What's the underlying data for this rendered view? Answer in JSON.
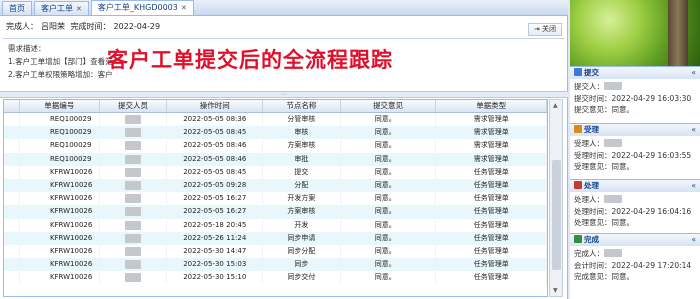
{
  "tabs": [
    {
      "label": "首页",
      "closable": false,
      "active": false
    },
    {
      "label": "客户工单",
      "closable": true,
      "active": false
    },
    {
      "label": "客户工单_KHGD0003",
      "closable": true,
      "active": true
    }
  ],
  "info": {
    "completer_label": "完成人：",
    "completer_value": "吕阳荣",
    "complete_time_label": "完成时间：",
    "complete_time_value": "2022-04-29",
    "close_button": "关闭",
    "desc_title": "需求描述：",
    "desc_line1": "1.客户工单增加【部门】查看范",
    "desc_line2": "2.客户工单权限策略增加：客户"
  },
  "overlay_title": "客户工单提交后的全流程跟踪",
  "grid": {
    "columns": [
      "单据编号",
      "提交人员",
      "操作时间",
      "节点名称",
      "提交意见",
      "单据类型"
    ],
    "rows": [
      [
        "REQ100029",
        "2022-05-05 08:36",
        "分管审核",
        "同意。",
        "需求管理单"
      ],
      [
        "REQ100029",
        "2022-05-05 08:45",
        "审核",
        "同意。",
        "需求管理单"
      ],
      [
        "REQ100029",
        "2022-05-05 08:46",
        "方案审核",
        "同意。",
        "需求管理单"
      ],
      [
        "REQ100029",
        "2022-05-05 08:46",
        "审批",
        "同意。",
        "需求管理单"
      ],
      [
        "KFRW10026",
        "2022-05-05 08:45",
        "提交",
        "同意。",
        "任务管理单"
      ],
      [
        "KFRW10026",
        "2022-05-05 09:28",
        "分配",
        "同意。",
        "任务管理单"
      ],
      [
        "KFRW10026",
        "2022-05-05 16:27",
        "开发方案",
        "同意。",
        "任务管理单"
      ],
      [
        "KFRW10026",
        "2022-05-05 16:27",
        "方案审核",
        "同意。",
        "任务管理单"
      ],
      [
        "KFRW10026",
        "2022-05-18 20:45",
        "开发",
        "同意。",
        "任务管理单"
      ],
      [
        "KFRW10026",
        "2022-05-26 11:24",
        "同步申请",
        "同意。",
        "任务管理单"
      ],
      [
        "KFRW10026",
        "2022-05-30 14:47",
        "同步分配",
        "同意。",
        "任务管理单"
      ],
      [
        "KFRW10026",
        "2022-05-30 15:03",
        "同步",
        "同意。",
        "任务管理单"
      ],
      [
        "KFRW10026",
        "2022-05-30 15:10",
        "同步交付",
        "同意。",
        "任务管理单"
      ]
    ]
  },
  "side": {
    "sections": [
      {
        "title": "提交",
        "icon_color": "#3a7bd5",
        "label1": "提交人：",
        "time_label": "提交时间：",
        "time": "2022-04-29 16:03:30",
        "opinion_label": "提交意见：",
        "opinion": "同意。"
      },
      {
        "title": "受理",
        "icon_color": "#d98a1c",
        "label1": "受理人：",
        "time_label": "受理时间：",
        "time": "2022-04-29 16:03:55",
        "opinion_label": "受理意见：",
        "opinion": "同意。"
      },
      {
        "title": "处理",
        "icon_color": "#c43c2c",
        "label1": "处理人：",
        "time_label": "处理时间：",
        "time": "2022-04-29 16:04:16",
        "opinion_label": "处理意见：",
        "opinion": "同意。"
      },
      {
        "title": "完成",
        "icon_color": "#2f8f3a",
        "label1": "完成人：",
        "time_label": "会计时间：",
        "time": "2022-04-29 17:20:14",
        "opinion_label": "完成意见：",
        "opinion": "同意。"
      }
    ]
  }
}
